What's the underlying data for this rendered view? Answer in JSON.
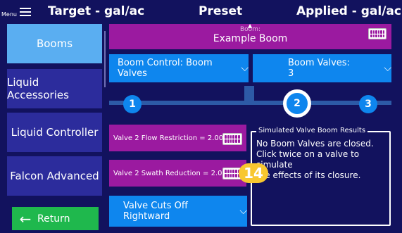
{
  "topbar": {
    "menu_label": "Menu",
    "left_title": "Target - gal/ac",
    "center_title": "Preset",
    "right_title": "Applied - gal/ac"
  },
  "sidebar": {
    "items": [
      {
        "label": "Booms",
        "active": true
      },
      {
        "label": "Liquid Accessories",
        "active": false
      },
      {
        "label": "Liquid Controller",
        "active": false
      },
      {
        "label": "Falcon Advanced",
        "active": false
      }
    ],
    "return_label": "Return"
  },
  "boom": {
    "header": "Boom:",
    "name": "Example Boom"
  },
  "dropdowns": {
    "boom_control": "Boom Control: Boom Valves",
    "boom_valves": "Boom Valves: 3",
    "valve_cuts": "Valve Cuts Off Rightward"
  },
  "stepper": {
    "nodes": [
      "1",
      "2",
      "3"
    ],
    "selected": "2"
  },
  "valve": {
    "flow_restriction": "Valve 2 Flow Restriction = 2.00 %",
    "swath_reduction": "Valve 2 Swath Reduction = 2.00 %"
  },
  "results": {
    "title": "Simulated Valve Boom Results",
    "line1": "No Boom Valves are closed.",
    "line2": "Click twice on a valve to simulate",
    "line3": "the effects of its closure."
  },
  "badge": "14",
  "colors": {
    "background": "#12125e",
    "sidebar_item": "#2c2c9c",
    "sidebar_active": "#5aaef1",
    "purple": "#9b1aa0",
    "blue": "#0e86ee",
    "return_green": "#1fb84d",
    "badge_yellow": "#f8c72f"
  }
}
